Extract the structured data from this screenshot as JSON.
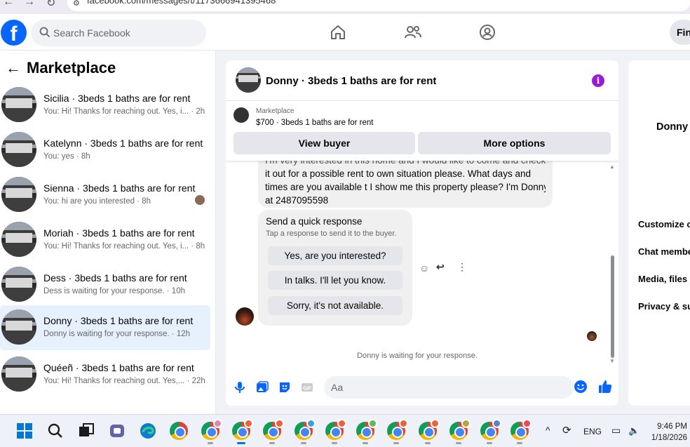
{
  "browser": {
    "url": "facebook.com/messages/t/1173666941395468"
  },
  "header": {
    "logo_letter": "f",
    "search_placeholder": "Search Facebook",
    "find_label": "Fin"
  },
  "sidebar": {
    "title": "Marketplace",
    "conversations": [
      {
        "name": "Sicilia · 3beds 1 baths are for rent",
        "preview": "You: Hi! Thanks for reaching out. Yes, i... · 2h",
        "active": false
      },
      {
        "name": "Katelynn · 3beds 1 baths are for rent",
        "preview": "You: yes · 8h",
        "active": false
      },
      {
        "name": "Sienna · 3beds 1 baths are for rent",
        "preview": "You: hi are you interested · 8h",
        "active": false
      },
      {
        "name": "Moriah · 3beds 1 baths are for rent",
        "preview": "You: Hi! Thanks for reaching out. Yes, i... · 8h",
        "active": false
      },
      {
        "name": "Dess · 3beds 1 baths are for rent",
        "preview": "Dess is waiting for your response. · 10h",
        "active": false
      },
      {
        "name": "Donny · 3beds 1 baths are for rent",
        "preview": "Donny is waiting for your response. · 12h",
        "active": true
      },
      {
        "name": "Quéeñ · 3beds 1 baths are for rent",
        "preview": "You: Hi! Thanks for reaching out. Yes,... · 22h",
        "active": false
      }
    ]
  },
  "chat": {
    "title": "Donny · 3beds 1 baths are for rent",
    "listing": {
      "label": "Marketplace",
      "price_title": "$700 · 3beds 1 baths are for rent",
      "view_buyer": "View buyer",
      "more_options": "More options"
    },
    "message_lines": [
      "I'm very interested in this home and I would like to come and check",
      "it out for a possible rent to own situation please. What days and",
      "times are you available t I show me this property please? I'm Donny",
      "at 2487095598"
    ],
    "quick_response": {
      "title": "Send a quick response",
      "subtitle": "Tap a response to send it to the buyer.",
      "options": [
        "Yes, are you interested?",
        "In talks. I'll let you know.",
        "Sorry, it's not available."
      ]
    },
    "waiting_text": "Donny is waiting for your response.",
    "composer_placeholder": "Aa"
  },
  "info_panel": {
    "name": "Donny",
    "items": [
      "Customize chat",
      "Chat members",
      "Media, files and links",
      "Privacy & support"
    ]
  },
  "taskbar": {
    "language": "ENG",
    "time": "9:46 PM",
    "date": "1/18/2026"
  },
  "colors": {
    "brand": "#0866ff",
    "active_conversation": "#e7f0fd",
    "info_button": "#9a1bd6"
  }
}
